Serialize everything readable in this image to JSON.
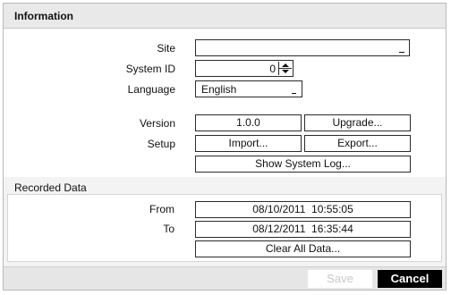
{
  "header": {
    "title": "Information"
  },
  "fields": {
    "site": {
      "label": "Site",
      "value": ""
    },
    "system_id": {
      "label": "System ID",
      "value": "0"
    },
    "language": {
      "label": "Language",
      "value": "English"
    },
    "version": {
      "label": "Version",
      "value": "1.0.0",
      "upgrade_label": "Upgrade..."
    },
    "setup": {
      "label": "Setup",
      "import_label": "Import...",
      "export_label": "Export..."
    },
    "show_system_log_label": "Show System Log..."
  },
  "recorded": {
    "title": "Recorded Data",
    "from_label": "From",
    "from_value": "08/10/2011  10:55:05",
    "to_label": "To",
    "to_value": "08/12/2011  16:35:44",
    "clear_label": "Clear All Data..."
  },
  "footer": {
    "save_label": "Save",
    "cancel_label": "Cancel"
  },
  "colors": {
    "cancel_bg": "#000000",
    "save_text_disabled": "#c8c8c8",
    "header_bg": "#e9e9e9"
  },
  "icons": {
    "spinner": "up-down-arrows-icon",
    "dropdown": "dropdown-indicator-icon"
  }
}
